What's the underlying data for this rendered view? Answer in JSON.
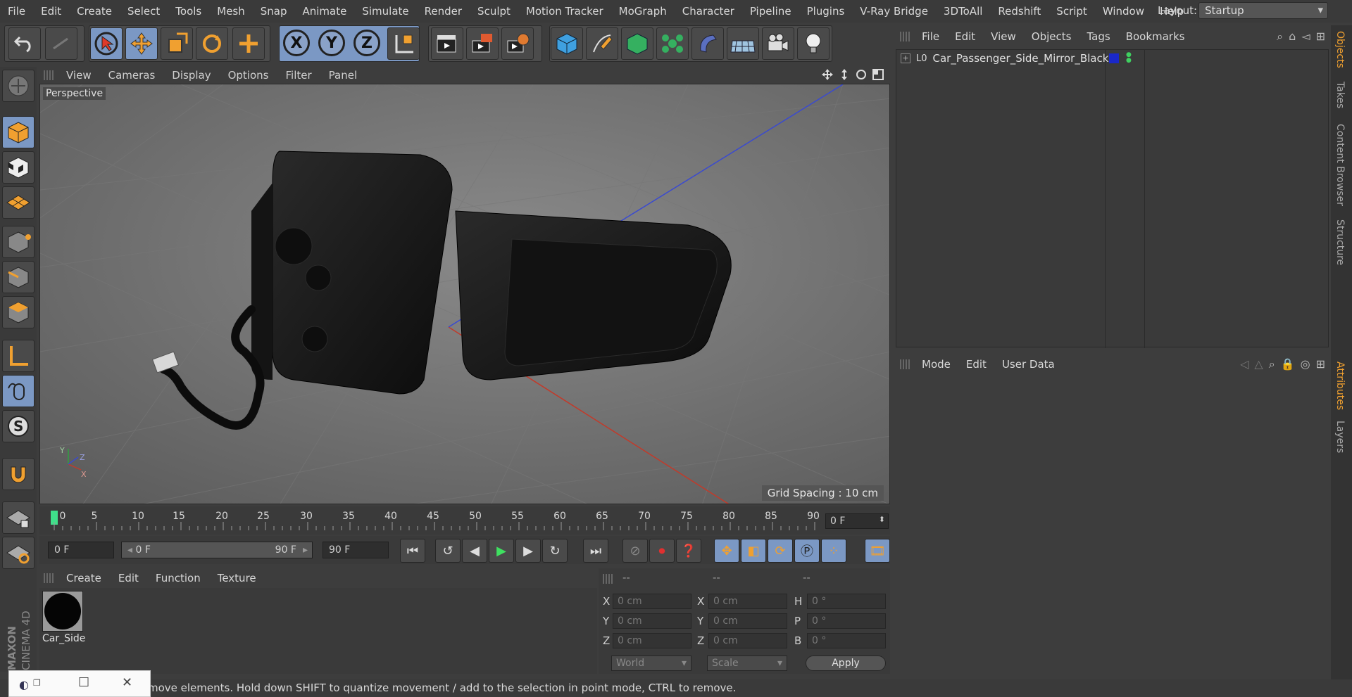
{
  "menubar": {
    "items": [
      "File",
      "Edit",
      "Create",
      "Select",
      "Tools",
      "Mesh",
      "Snap",
      "Animate",
      "Simulate",
      "Render",
      "Sculpt",
      "Motion Tracker",
      "MoGraph",
      "Character",
      "Pipeline",
      "Plugins",
      "V-Ray Bridge",
      "3DToAll",
      "Redshift",
      "Script",
      "Window",
      "Help"
    ],
    "layout_label": "Layout:",
    "layout_value": "Startup"
  },
  "toolbar": {
    "x_label": "X",
    "y_label": "Y",
    "z_label": "Z"
  },
  "viewport": {
    "menu": [
      "View",
      "Cameras",
      "Display",
      "Options",
      "Filter",
      "Panel"
    ],
    "camera_label": "Perspective",
    "grid_spacing": "Grid Spacing : 10 cm",
    "axis_y": "Y",
    "axis_z": "Z",
    "axis_x": "X"
  },
  "timeline": {
    "ticks": [
      "0",
      "5",
      "10",
      "15",
      "20",
      "25",
      "30",
      "35",
      "40",
      "45",
      "50",
      "55",
      "60",
      "65",
      "70",
      "75",
      "80",
      "85",
      "90"
    ],
    "current_frame": "0 F"
  },
  "transport": {
    "start_field": "0 F",
    "range_start": "0 F",
    "range_end": "90 F",
    "end_field": "90 F"
  },
  "materials": {
    "menu": [
      "Create",
      "Edit",
      "Function",
      "Texture"
    ],
    "material_name": "Car_Side"
  },
  "coordinates": {
    "header": [
      "--",
      "--",
      "--"
    ],
    "pos_labels": [
      "X",
      "Y",
      "Z"
    ],
    "size_labels": [
      "X",
      "Y",
      "Z"
    ],
    "rot_labels": [
      "H",
      "P",
      "B"
    ],
    "pos_values": [
      "0 cm",
      "0 cm",
      "0 cm"
    ],
    "size_values": [
      "0 cm",
      "0 cm",
      "0 cm"
    ],
    "rot_values": [
      "0 °",
      "0 °",
      "0 °"
    ],
    "mode_world": "World",
    "mode_scale": "Scale",
    "apply_label": "Apply"
  },
  "objects_panel": {
    "menu": [
      "File",
      "Edit",
      "View",
      "Objects",
      "Tags",
      "Bookmarks"
    ],
    "object_name": "Car_Passenger_Side_Mirror_Black",
    "layer_badge": "L0"
  },
  "attributes_panel": {
    "menu": [
      "Mode",
      "Edit",
      "User Data"
    ]
  },
  "side_tabs": [
    "Objects",
    "Takes",
    "Content Browser",
    "Structure",
    "Attributes",
    "Layers"
  ],
  "status": {
    "text": "move elements. Hold down SHIFT to quantize movement / add to the selection in point mode, CTRL to remove."
  },
  "branding": "MAXON CINEMA 4D"
}
